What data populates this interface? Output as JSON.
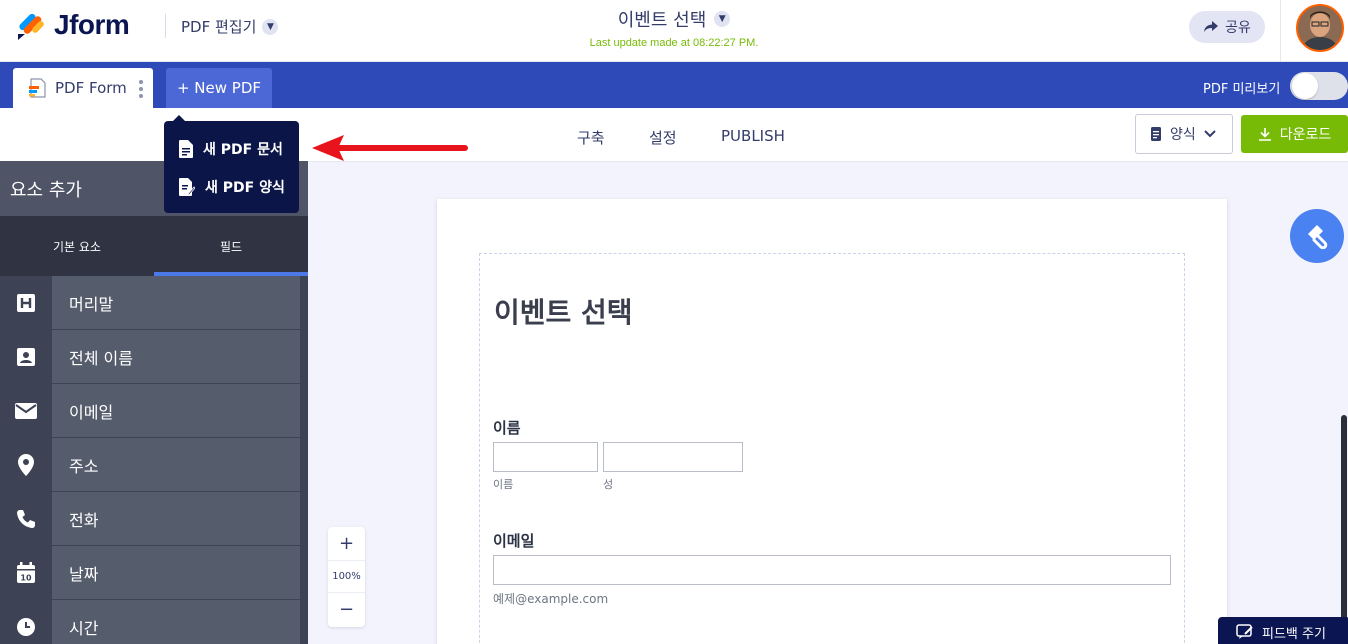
{
  "header": {
    "logo_text": "Jform",
    "editor_switch": "PDF 편집기",
    "form_title": "이벤트 선택",
    "last_update": "Last update made at 08:22:27 PM.",
    "share_label": "공유"
  },
  "navbar": {
    "tab_label": "PDF Form",
    "new_pdf_label": "+ New PDF",
    "preview_label": "PDF 미리보기"
  },
  "dropdown": {
    "items": [
      {
        "label": "새 PDF 문서"
      },
      {
        "label": "새 PDF 양식"
      }
    ]
  },
  "subbar": {
    "tabs": [
      "구축",
      "설정",
      "PUBLISH"
    ],
    "form_select": "양식",
    "download_label": "다운로드"
  },
  "sidebar": {
    "title": "요소 추가",
    "tabs": [
      "기본 요소",
      "필드"
    ],
    "items": [
      {
        "label": "머리말",
        "icon": "heading-icon"
      },
      {
        "label": "전체 이름",
        "icon": "user-card-icon"
      },
      {
        "label": "이메일",
        "icon": "envelope-icon"
      },
      {
        "label": "주소",
        "icon": "map-pin-icon"
      },
      {
        "label": "전화",
        "icon": "phone-icon"
      },
      {
        "label": "날짜",
        "icon": "calendar-icon"
      },
      {
        "label": "시간",
        "icon": "clock-icon"
      }
    ]
  },
  "form": {
    "heading": "이벤트 선택",
    "name_label": "이름",
    "first_sublabel": "이름",
    "last_sublabel": "성",
    "email_label": "이메일",
    "email_sublabel": "예제@example.com"
  },
  "zoom": {
    "plus": "+",
    "level": "100%",
    "minus": "−"
  },
  "feedback_label": "피드백 주기",
  "colors": {
    "brand_navy": "#0a1551",
    "nav_blue": "#2e4ab8",
    "accent_green": "#78bb07",
    "arrow_red": "#e8141b"
  }
}
